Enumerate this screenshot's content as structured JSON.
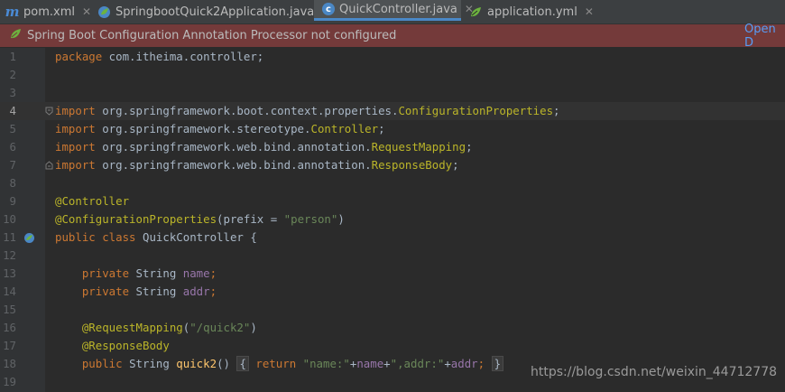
{
  "tabs": [
    {
      "label": "pom.xml",
      "icon": "maven-icon",
      "active": false
    },
    {
      "label": "SpringbootQuick2Application.java",
      "icon": "spring-boot-class-icon",
      "active": false
    },
    {
      "label": "QuickController.java",
      "icon": "class-icon",
      "active": true
    },
    {
      "label": "application.yml",
      "icon": "spring-yaml-icon",
      "active": false
    }
  ],
  "banner": {
    "message": "Spring Boot Configuration Annotation Processor not configured",
    "link": "Open D"
  },
  "editor": {
    "current_line": 4,
    "lines": [
      {
        "n": "1",
        "text": "package com.itheima.controller;"
      },
      {
        "n": "2",
        "text": ""
      },
      {
        "n": "3",
        "text": ""
      },
      {
        "n": "4",
        "text": "import org.springframework.boot.context.properties.ConfigurationProperties;"
      },
      {
        "n": "5",
        "text": "import org.springframework.stereotype.Controller;"
      },
      {
        "n": "6",
        "text": "import org.springframework.web.bind.annotation.RequestMapping;"
      },
      {
        "n": "7",
        "text": "import org.springframework.web.bind.annotation.ResponseBody;"
      },
      {
        "n": "8",
        "text": ""
      },
      {
        "n": "9",
        "text": "@Controller"
      },
      {
        "n": "10",
        "text": "@ConfigurationProperties(prefix = \"person\")"
      },
      {
        "n": "11",
        "text": "public class QuickController {"
      },
      {
        "n": "12",
        "text": ""
      },
      {
        "n": "13",
        "text": "    private String name;"
      },
      {
        "n": "14",
        "text": "    private String addr;"
      },
      {
        "n": "15",
        "text": ""
      },
      {
        "n": "16",
        "text": "    @RequestMapping(\"/quick2\")"
      },
      {
        "n": "17",
        "text": "    @ResponseBody"
      },
      {
        "n": "18",
        "text": "    public String quick2() { return \"name:\"+name+\",addr:\"+addr; }"
      },
      {
        "n": "19",
        "text": ""
      }
    ]
  },
  "watermark": "https://blog.csdn.net/weixin_44712778"
}
